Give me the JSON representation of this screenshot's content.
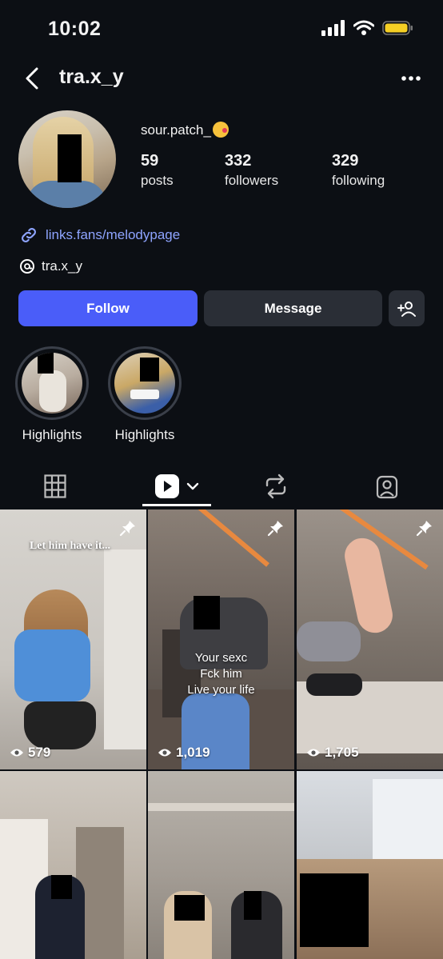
{
  "status": {
    "time": "10:02"
  },
  "header": {
    "username": "tra.x_y"
  },
  "profile": {
    "display_name": "sour.patch_",
    "stats": [
      {
        "num": "59",
        "label": "posts"
      },
      {
        "num": "332",
        "label": "followers"
      },
      {
        "num": "329",
        "label": "following"
      }
    ],
    "link": "links.fans/melodypage",
    "threads_handle": "tra.x_y"
  },
  "actions": {
    "follow": "Follow",
    "message": "Message"
  },
  "highlights": [
    {
      "label": "Highlights"
    },
    {
      "label": "Highlights"
    }
  ],
  "posts": [
    {
      "views": "579",
      "overlay": "Let him have it...",
      "pinned": true
    },
    {
      "views": "1,019",
      "overlay_lines": [
        "Your sexc",
        "Fck him",
        "Live your life"
      ],
      "pinned": true
    },
    {
      "views": "1,705",
      "pinned": true
    },
    {
      "views": ""
    },
    {
      "views": ""
    },
    {
      "views": ""
    }
  ],
  "colors": {
    "accent": "#4a5df9",
    "link": "#8ea4ff",
    "background": "#0c0f14",
    "button_secondary": "#2a2e36"
  },
  "icons": [
    "back-icon",
    "more-icon",
    "link-icon",
    "threads-icon",
    "add-person-icon",
    "grid-icon",
    "reels-icon",
    "chevron-down-icon",
    "reposts-icon",
    "tagged-icon",
    "pin-icon",
    "eye-icon"
  ]
}
